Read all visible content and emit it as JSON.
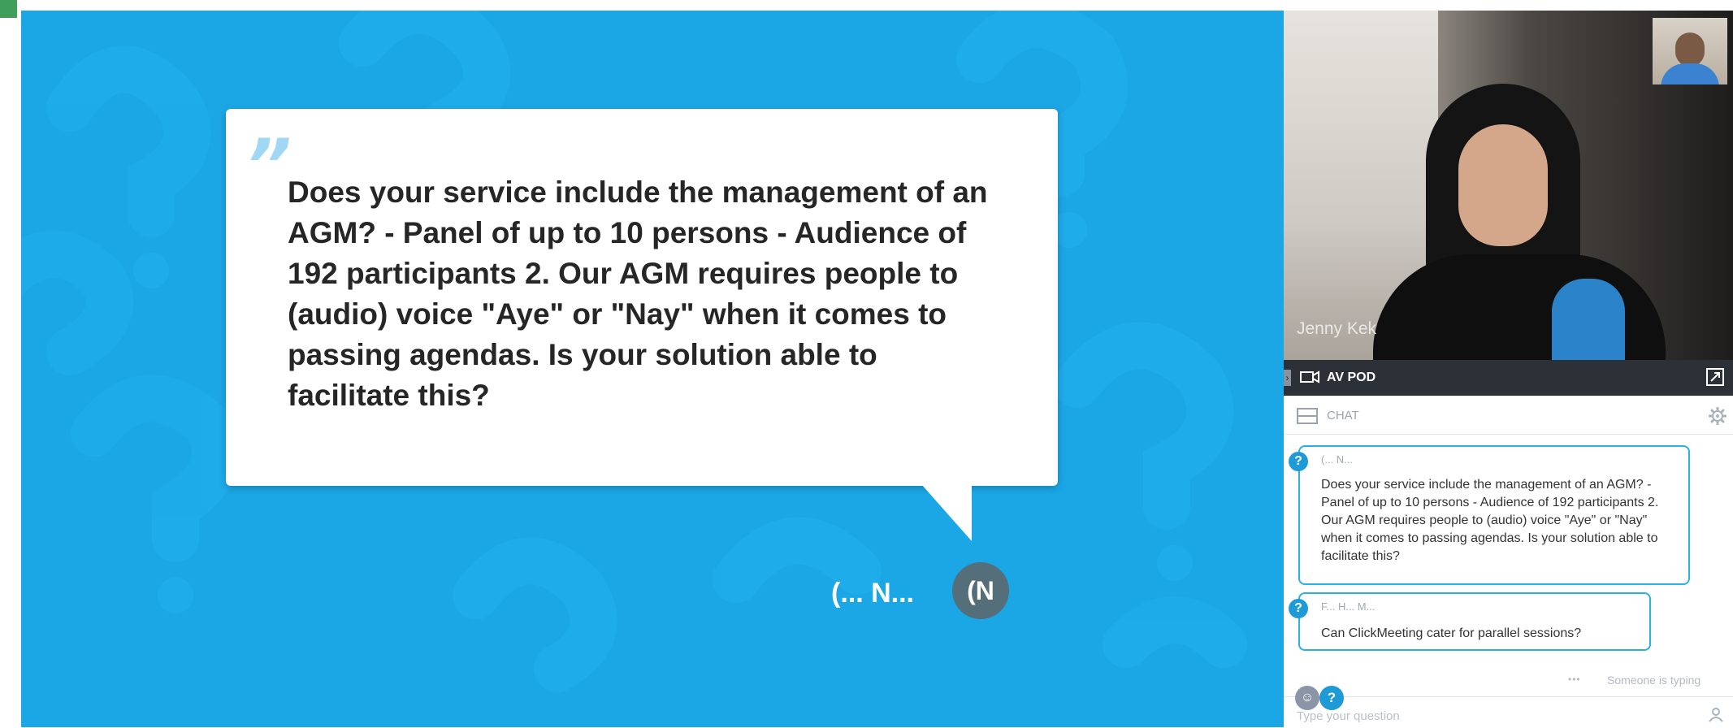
{
  "presentation": {
    "question_text": "Does your service include the management of an AGM? - Panel of up to 10 persons - Audience of 192 participants 2. Our AGM requires people to (audio) voice \"Aye\" or \"Nay\" when it comes to passing agendas. Is your solution able to facilitate this?",
    "asker_name": "(... N...",
    "asker_avatar_initials": "(N",
    "quote_mark": "”",
    "background_color": "#1ba7e6"
  },
  "video": {
    "presenter_name": "Jenny Kek"
  },
  "av_pod": {
    "label": "AV POD"
  },
  "chat": {
    "label": "CHAT",
    "messages": [
      {
        "author": "(... N...",
        "text": "Does your service include the management of an AGM? - Panel of up to 10 persons - Audience of 192 participants 2. Our AGM requires people to (audio) voice \"Aye\" or \"Nay\" when it comes to passing agendas. Is your solution able to facilitate this?"
      },
      {
        "author": "F... H... M...",
        "text": "Can ClickMeeting cater for parallel sessions?"
      }
    ],
    "typing_indicator": "Someone is typing",
    "question_badge": "?",
    "input_placeholder": "Type your question",
    "accent_color": "#2ab0e2"
  }
}
